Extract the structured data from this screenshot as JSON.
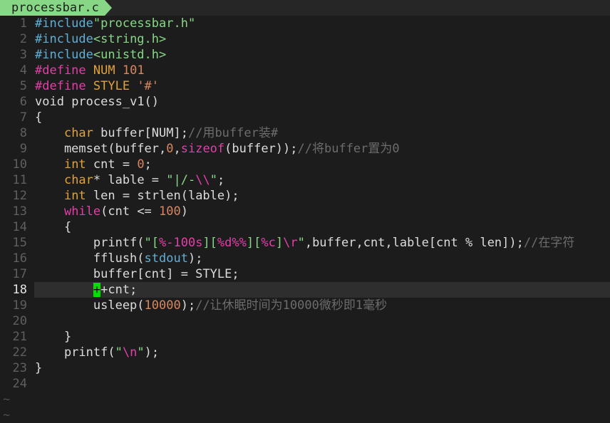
{
  "tab": {
    "filename": "processbar.c"
  },
  "colors": {
    "background": "#1c1c1c",
    "line_number": "#5f5f5f",
    "preproc": "#5fafd7",
    "string": "#87d787",
    "type": "#e0a23a",
    "keyword": "#e23fa8",
    "number": "#d7875f",
    "comment": "#6c6c6c",
    "ident": "#dcdcdc",
    "cursor": "#00e000"
  },
  "current_line": 18,
  "lines": [
    {
      "num": "1",
      "tokens": [
        {
          "t": "#include",
          "c": "preproc"
        },
        {
          "t": "\"processbar.h\"",
          "c": "string"
        }
      ]
    },
    {
      "num": "2",
      "tokens": [
        {
          "t": "#include",
          "c": "preproc"
        },
        {
          "t": "<string.h>",
          "c": "string"
        }
      ]
    },
    {
      "num": "3",
      "tokens": [
        {
          "t": "#include",
          "c": "preproc"
        },
        {
          "t": "<unistd.h>",
          "c": "string"
        }
      ]
    },
    {
      "num": "4",
      "tokens": [
        {
          "t": "#define",
          "c": "keyword"
        },
        {
          "t": " NUM ",
          "c": "type"
        },
        {
          "t": "101",
          "c": "number"
        }
      ]
    },
    {
      "num": "5",
      "tokens": [
        {
          "t": "#define",
          "c": "keyword"
        },
        {
          "t": " STYLE ",
          "c": "type"
        },
        {
          "t": "'#'",
          "c": "number"
        }
      ]
    },
    {
      "num": "6",
      "tokens": [
        {
          "t": "void",
          "c": "ident"
        },
        {
          "t": " process_v1()",
          "c": "ident"
        }
      ]
    },
    {
      "num": "7",
      "tokens": [
        {
          "t": "{",
          "c": "ident"
        }
      ]
    },
    {
      "num": "8",
      "tokens": [
        {
          "t": "    ",
          "c": "ident"
        },
        {
          "t": "char",
          "c": "type"
        },
        {
          "t": " buffer[NUM];",
          "c": "ident"
        },
        {
          "t": "//用buffer装#",
          "c": "comment"
        }
      ]
    },
    {
      "num": "9",
      "tokens": [
        {
          "t": "    memset(buffer,",
          "c": "ident"
        },
        {
          "t": "0",
          "c": "number"
        },
        {
          "t": ",",
          "c": "ident"
        },
        {
          "t": "sizeof",
          "c": "keyword"
        },
        {
          "t": "(buffer));",
          "c": "ident"
        },
        {
          "t": "//将buffer置为0",
          "c": "comment"
        }
      ]
    },
    {
      "num": "10",
      "tokens": [
        {
          "t": "    ",
          "c": "ident"
        },
        {
          "t": "int",
          "c": "type"
        },
        {
          "t": " cnt = ",
          "c": "ident"
        },
        {
          "t": "0",
          "c": "number"
        },
        {
          "t": ";",
          "c": "ident"
        }
      ]
    },
    {
      "num": "11",
      "tokens": [
        {
          "t": "    ",
          "c": "ident"
        },
        {
          "t": "char",
          "c": "type"
        },
        {
          "t": "* lable = ",
          "c": "ident"
        },
        {
          "t": "\"|/-",
          "c": "string"
        },
        {
          "t": "\\\\",
          "c": "keyword"
        },
        {
          "t": "\"",
          "c": "string"
        },
        {
          "t": ";",
          "c": "ident"
        }
      ]
    },
    {
      "num": "12",
      "tokens": [
        {
          "t": "    ",
          "c": "ident"
        },
        {
          "t": "int",
          "c": "type"
        },
        {
          "t": " len = strlen(lable);",
          "c": "ident"
        }
      ]
    },
    {
      "num": "13",
      "tokens": [
        {
          "t": "    ",
          "c": "ident"
        },
        {
          "t": "while",
          "c": "keyword"
        },
        {
          "t": "(cnt <= ",
          "c": "ident"
        },
        {
          "t": "100",
          "c": "number"
        },
        {
          "t": ")",
          "c": "ident"
        }
      ]
    },
    {
      "num": "14",
      "tokens": [
        {
          "t": "    {",
          "c": "ident"
        }
      ]
    },
    {
      "num": "15",
      "tokens": [
        {
          "t": "        printf(",
          "c": "ident"
        },
        {
          "t": "\"[",
          "c": "string"
        },
        {
          "t": "%-100s",
          "c": "keyword"
        },
        {
          "t": "][",
          "c": "string"
        },
        {
          "t": "%d%%",
          "c": "keyword"
        },
        {
          "t": "][",
          "c": "string"
        },
        {
          "t": "%c",
          "c": "keyword"
        },
        {
          "t": "]",
          "c": "string"
        },
        {
          "t": "\\r",
          "c": "keyword"
        },
        {
          "t": "\"",
          "c": "string"
        },
        {
          "t": ",buffer,cnt,lable[cnt % len]);",
          "c": "ident"
        },
        {
          "t": "//在字符",
          "c": "comment"
        }
      ]
    },
    {
      "num": "16",
      "tokens": [
        {
          "t": "        fflush(",
          "c": "ident"
        },
        {
          "t": "stdout",
          "c": "preproc"
        },
        {
          "t": ");",
          "c": "ident"
        }
      ]
    },
    {
      "num": "17",
      "tokens": [
        {
          "t": "        buffer[cnt] = STYLE;",
          "c": "ident"
        }
      ]
    },
    {
      "num": "18",
      "tokens": [
        {
          "t": "        ",
          "c": "ident"
        },
        {
          "t": "+",
          "c": "cursor"
        },
        {
          "t": "+cnt;",
          "c": "ident"
        }
      ]
    },
    {
      "num": "19",
      "tokens": [
        {
          "t": "        usleep(",
          "c": "ident"
        },
        {
          "t": "10000",
          "c": "number"
        },
        {
          "t": ");",
          "c": "ident"
        },
        {
          "t": "//让休眠时间为10000微秒即1毫秒",
          "c": "comment"
        }
      ]
    },
    {
      "num": "20",
      "tokens": []
    },
    {
      "num": "21",
      "tokens": [
        {
          "t": "    }",
          "c": "ident"
        }
      ]
    },
    {
      "num": "22",
      "tokens": [
        {
          "t": "    printf(",
          "c": "ident"
        },
        {
          "t": "\"",
          "c": "string"
        },
        {
          "t": "\\n",
          "c": "keyword"
        },
        {
          "t": "\"",
          "c": "string"
        },
        {
          "t": ");",
          "c": "ident"
        }
      ]
    },
    {
      "num": "23",
      "tokens": [
        {
          "t": "}",
          "c": "ident"
        }
      ]
    },
    {
      "num": "24",
      "tokens": []
    }
  ],
  "filler": [
    "~",
    "~"
  ]
}
